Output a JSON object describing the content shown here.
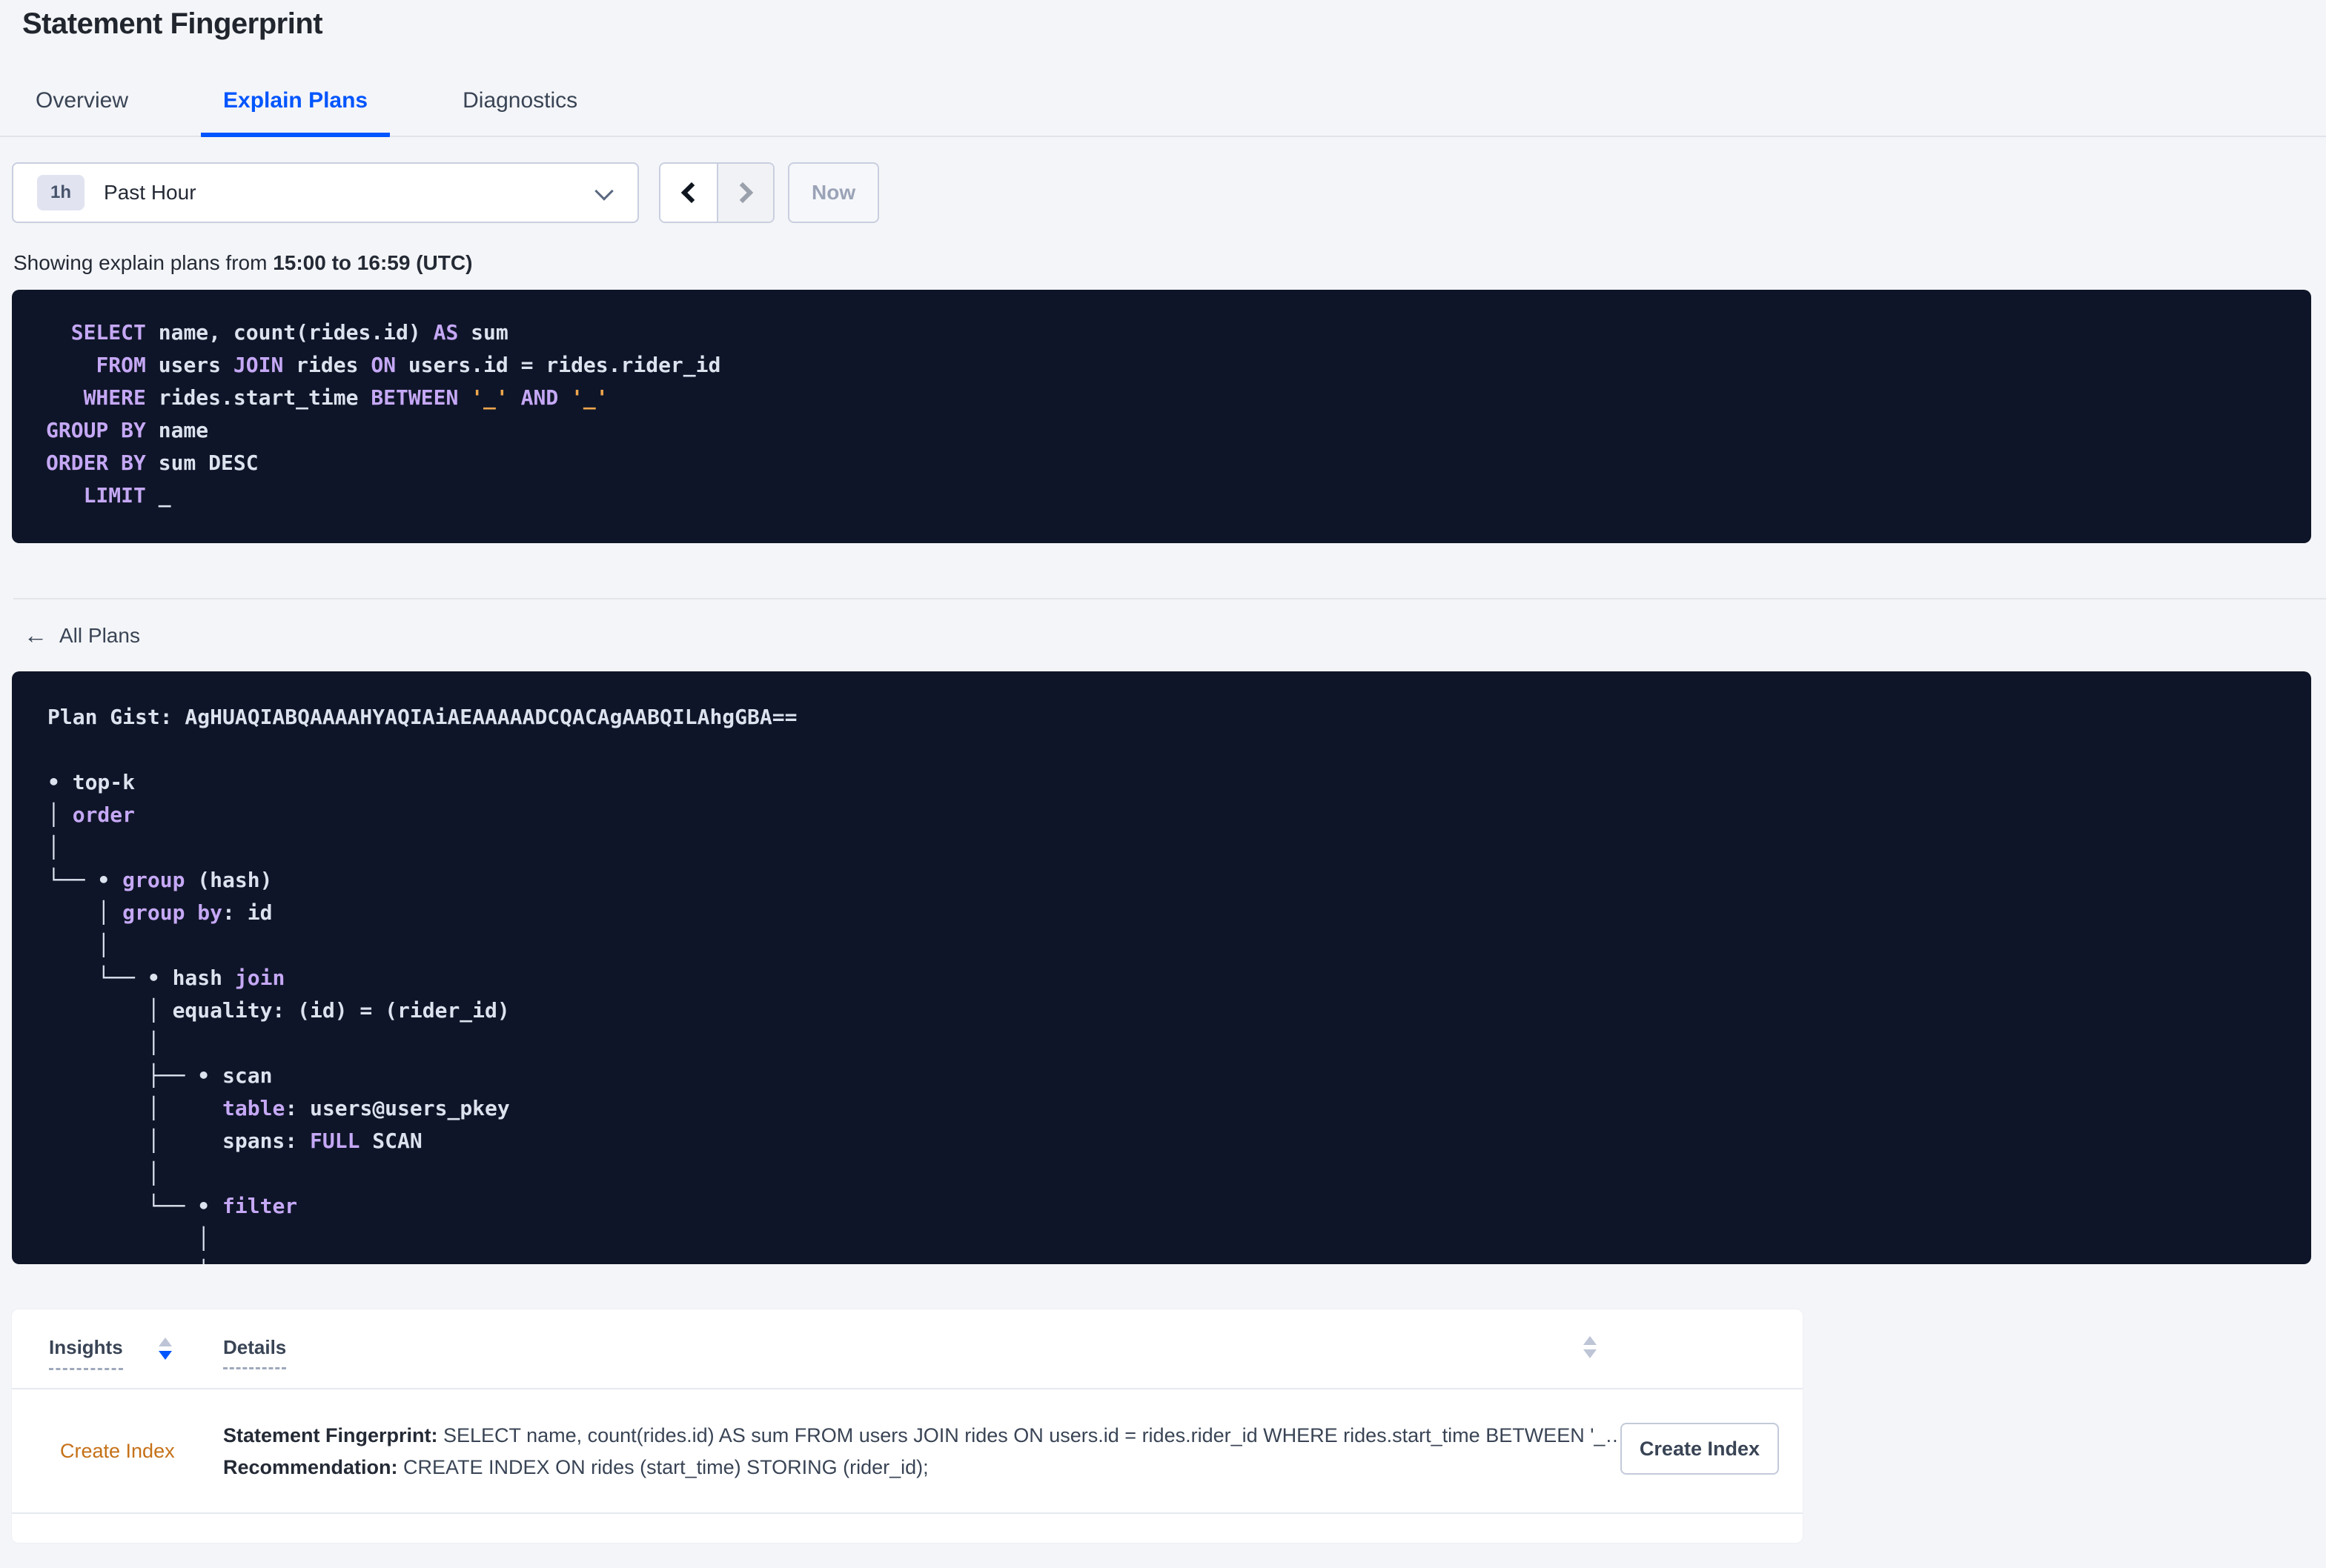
{
  "page": {
    "title": "Statement Fingerprint"
  },
  "tabs": [
    {
      "label": "Overview",
      "active": false
    },
    {
      "label": "Explain Plans",
      "active": true
    },
    {
      "label": "Diagnostics",
      "active": false
    }
  ],
  "time_picker": {
    "interval_badge": "1h",
    "selected_label": "Past Hour",
    "now_label": "Now"
  },
  "showing": {
    "prefix": "Showing explain plans from ",
    "range": "15:00 to 16:59 (UTC)"
  },
  "sql_box": {
    "lines": [
      [
        {
          "c": "tx",
          "t": "  "
        },
        {
          "c": "kw",
          "t": "SELECT"
        },
        {
          "c": "tx",
          "t": " name, count(rides.id) "
        },
        {
          "c": "kw",
          "t": "AS"
        },
        {
          "c": "tx",
          "t": " sum"
        }
      ],
      [
        {
          "c": "tx",
          "t": "    "
        },
        {
          "c": "kw",
          "t": "FROM"
        },
        {
          "c": "tx",
          "t": " users "
        },
        {
          "c": "kw",
          "t": "JOIN"
        },
        {
          "c": "tx",
          "t": " rides "
        },
        {
          "c": "kw",
          "t": "ON"
        },
        {
          "c": "tx",
          "t": " users.id = rides.rider_id"
        }
      ],
      [
        {
          "c": "tx",
          "t": "   "
        },
        {
          "c": "kw",
          "t": "WHERE"
        },
        {
          "c": "tx",
          "t": " rides.start_time "
        },
        {
          "c": "kw",
          "t": "BETWEEN"
        },
        {
          "c": "tx",
          "t": " "
        },
        {
          "c": "lit",
          "t": "'_'"
        },
        {
          "c": "tx",
          "t": " "
        },
        {
          "c": "kw",
          "t": "AND"
        },
        {
          "c": "tx",
          "t": " "
        },
        {
          "c": "lit",
          "t": "'_'"
        }
      ],
      [
        {
          "c": "kw",
          "t": "GROUP BY"
        },
        {
          "c": "tx",
          "t": " name"
        }
      ],
      [
        {
          "c": "kw",
          "t": "ORDER BY"
        },
        {
          "c": "tx",
          "t": " sum DESC"
        }
      ],
      [
        {
          "c": "tx",
          "t": "   "
        },
        {
          "c": "kw",
          "t": "LIMIT"
        },
        {
          "c": "tx",
          "t": " _"
        }
      ]
    ]
  },
  "plans_section": {
    "back_label": "All Plans"
  },
  "gist_box": {
    "lines": [
      [
        {
          "c": "tx",
          "t": "Plan Gist: AgHUAQIABQAAAAHYAQIAiAEAAAAADCQACAgAABQILAhgGBA=="
        }
      ],
      [],
      [
        {
          "c": "tx",
          "t": "• top-k"
        }
      ],
      [
        {
          "c": "tx",
          "t": "│ "
        },
        {
          "c": "kw",
          "t": "order"
        }
      ],
      [
        {
          "c": "tx",
          "t": "│"
        }
      ],
      [
        {
          "c": "tx",
          "t": "└── • "
        },
        {
          "c": "kw",
          "t": "group"
        },
        {
          "c": "tx",
          "t": " (hash)"
        }
      ],
      [
        {
          "c": "tx",
          "t": "    │ "
        },
        {
          "c": "kw",
          "t": "group by"
        },
        {
          "c": "tx",
          "t": ": id"
        }
      ],
      [
        {
          "c": "tx",
          "t": "    │"
        }
      ],
      [
        {
          "c": "tx",
          "t": "    └── • hash "
        },
        {
          "c": "kw",
          "t": "join"
        }
      ],
      [
        {
          "c": "tx",
          "t": "        │ equality: (id) = (rider_id)"
        }
      ],
      [
        {
          "c": "tx",
          "t": "        │"
        }
      ],
      [
        {
          "c": "tx",
          "t": "        ├── • scan"
        }
      ],
      [
        {
          "c": "tx",
          "t": "        │     "
        },
        {
          "c": "kw",
          "t": "table"
        },
        {
          "c": "tx",
          "t": ": users@users_pkey"
        }
      ],
      [
        {
          "c": "tx",
          "t": "        │     spans: "
        },
        {
          "c": "kw",
          "t": "FULL"
        },
        {
          "c": "tx",
          "t": " SCAN"
        }
      ],
      [
        {
          "c": "tx",
          "t": "        │"
        }
      ],
      [
        {
          "c": "tx",
          "t": "        └── • "
        },
        {
          "c": "kw",
          "t": "filter"
        }
      ],
      [
        {
          "c": "tx",
          "t": "            │"
        }
      ],
      [
        {
          "c": "tx",
          "t": "            │"
        }
      ]
    ]
  },
  "insights_table": {
    "header": {
      "insights": "Insights",
      "details": "Details"
    },
    "row": {
      "insight_link": "Create Index",
      "statement_label": "Statement Fingerprint:",
      "statement": " SELECT name, count(rides.id) AS sum FROM users JOIN rides ON users.id = rides.rider_id WHERE rides.start_time BETWEEN '_…",
      "recommendation_label": "Recommendation:",
      "recommendation": " CREATE INDEX ON rides (start_time) STORING (rider_id);",
      "action_button": "Create Index"
    }
  },
  "colors": {
    "accent_blue": "#0055ff",
    "code_background": "#0e1528",
    "keyword_purple": "#c5a8f5",
    "literal_orange": "#efa64d",
    "code_text": "#dce2ee",
    "insight_orange": "#c57118"
  }
}
